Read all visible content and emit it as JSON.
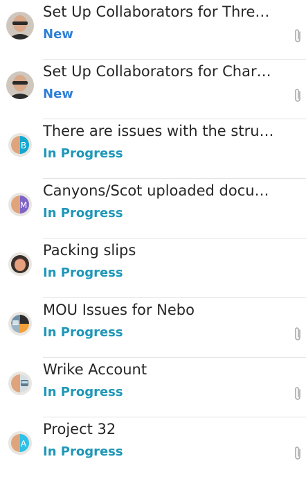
{
  "colors": {
    "status_new": "#2f7fd6",
    "status_in_progress": "#1e97b8",
    "divider": "#e3e3e3",
    "title": "#262626",
    "clip": "#a8a8a8"
  },
  "tasks": [
    {
      "title": "Set Up Collaborators for Thre…",
      "status": "New",
      "status_kind": "new",
      "has_attachment": true,
      "avatar": "photo-man"
    },
    {
      "title": "Set Up Collaborators for Char…",
      "status": "New",
      "status_kind": "new",
      "has_attachment": true,
      "avatar": "photo-man"
    },
    {
      "title": "There are issues with the stru…",
      "status": "In Progress",
      "status_kind": "in-progress",
      "has_attachment": false,
      "avatar": "pair-b",
      "avatar_letter": "B"
    },
    {
      "title": "Canyons/Scot uploaded docu…",
      "status": "In Progress",
      "status_kind": "in-progress",
      "has_attachment": false,
      "avatar": "pair-m",
      "avatar_letter": "M"
    },
    {
      "title": "Packing slips",
      "status": "In Progress",
      "status_kind": "in-progress",
      "has_attachment": false,
      "avatar": "single-woman"
    },
    {
      "title": "MOU Issues for Nebo",
      "status": "In Progress",
      "status_kind": "in-progress",
      "has_attachment": true,
      "avatar": "group-quad"
    },
    {
      "title": "Wrike Account",
      "status": "In Progress",
      "status_kind": "in-progress",
      "has_attachment": true,
      "avatar": "pair-bus"
    },
    {
      "title": "Project 32",
      "status": "In Progress",
      "status_kind": "in-progress",
      "has_attachment": true,
      "avatar": "pair-a",
      "avatar_letter": "A"
    }
  ]
}
